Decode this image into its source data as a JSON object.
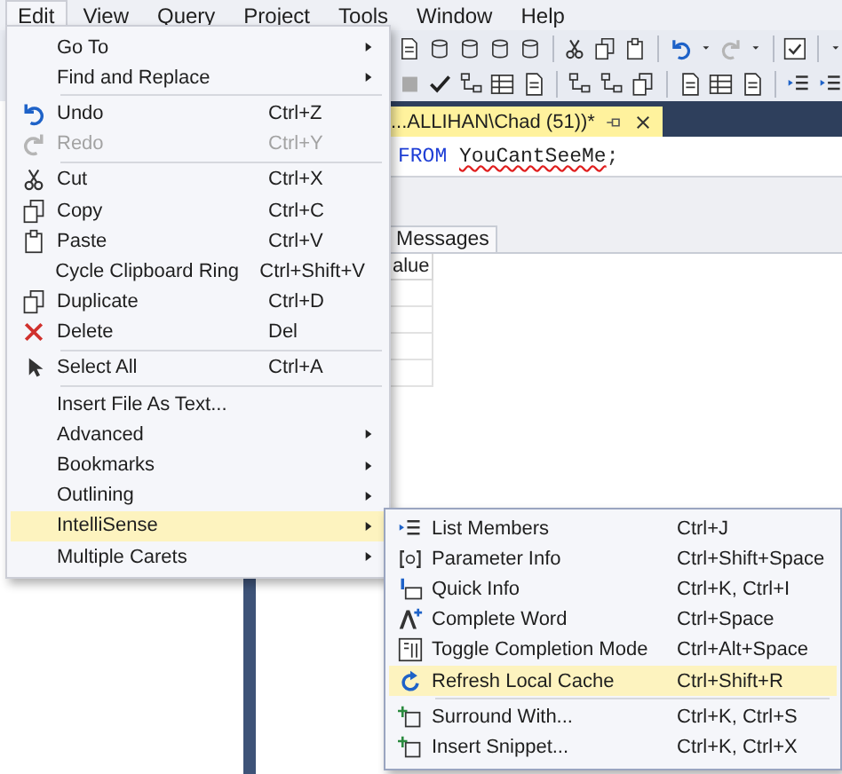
{
  "menu_bar": [
    {
      "label": "Edit",
      "selected": true
    },
    {
      "label": "View",
      "selected": false
    },
    {
      "label": "Query",
      "selected": false
    },
    {
      "label": "Project",
      "selected": false
    },
    {
      "label": "Tools",
      "selected": false
    },
    {
      "label": "Window",
      "selected": false
    },
    {
      "label": "Help",
      "selected": false
    }
  ],
  "editor_tab": {
    "title": "...ALLIHAN\\Chad (51))*"
  },
  "code_line": [
    {
      "text": "FROM",
      "kind": "keyword"
    },
    {
      "text": "YouCantSeeMe",
      "kind": "error"
    },
    {
      "text": ";",
      "kind": "plain"
    }
  ],
  "results_tabs": [
    {
      "label": "Messages"
    }
  ],
  "grid": {
    "column": "alue"
  },
  "edit_menu": {
    "items": [
      {
        "kind": "item",
        "label": "Go To",
        "submenu": true,
        "disabled": false,
        "selected": false
      },
      {
        "kind": "item",
        "label": "Find and Replace",
        "submenu": true,
        "disabled": false,
        "selected": false
      },
      {
        "kind": "separator"
      },
      {
        "kind": "item",
        "label": "Undo",
        "shortcut": "Ctrl+Z",
        "submenu": false,
        "disabled": false,
        "selected": false
      },
      {
        "kind": "item",
        "label": "Redo",
        "shortcut": "Ctrl+Y",
        "submenu": false,
        "disabled": true,
        "selected": false
      },
      {
        "kind": "separator"
      },
      {
        "kind": "item",
        "label": "Cut",
        "shortcut": "Ctrl+X",
        "submenu": false,
        "disabled": false,
        "selected": false
      },
      {
        "kind": "item",
        "label": "Copy",
        "shortcut": "Ctrl+C",
        "submenu": false,
        "disabled": false,
        "selected": false
      },
      {
        "kind": "item",
        "label": "Paste",
        "shortcut": "Ctrl+V",
        "submenu": false,
        "disabled": false,
        "selected": false
      },
      {
        "kind": "item",
        "label": "Cycle Clipboard Ring",
        "shortcut": "Ctrl+Shift+V",
        "submenu": false,
        "disabled": false,
        "selected": false
      },
      {
        "kind": "item",
        "label": "Duplicate",
        "shortcut": "Ctrl+D",
        "submenu": false,
        "disabled": false,
        "selected": false
      },
      {
        "kind": "item",
        "label": "Delete",
        "shortcut": "Del",
        "submenu": false,
        "disabled": false,
        "selected": false
      },
      {
        "kind": "separator"
      },
      {
        "kind": "item",
        "label": "Select All",
        "shortcut": "Ctrl+A",
        "submenu": false,
        "disabled": false,
        "selected": false
      },
      {
        "kind": "separator"
      },
      {
        "kind": "item",
        "label": "Insert File As Text...",
        "submenu": false,
        "disabled": false,
        "selected": false
      },
      {
        "kind": "item",
        "label": "Advanced",
        "submenu": true,
        "disabled": false,
        "selected": false
      },
      {
        "kind": "item",
        "label": "Bookmarks",
        "submenu": true,
        "disabled": false,
        "selected": false
      },
      {
        "kind": "item",
        "label": "Outlining",
        "submenu": true,
        "disabled": false,
        "selected": false
      },
      {
        "kind": "item",
        "label": "IntelliSense",
        "submenu": true,
        "disabled": false,
        "selected": true
      },
      {
        "kind": "item",
        "label": "Multiple Carets",
        "submenu": true,
        "disabled": false,
        "selected": false
      }
    ]
  },
  "intellisense_menu": {
    "items": [
      {
        "kind": "item",
        "label": "List Members",
        "shortcut": "Ctrl+J",
        "selected": false
      },
      {
        "kind": "item",
        "label": "Parameter Info",
        "shortcut": "Ctrl+Shift+Space",
        "selected": false
      },
      {
        "kind": "item",
        "label": "Quick Info",
        "shortcut": "Ctrl+K, Ctrl+I",
        "selected": false
      },
      {
        "kind": "item",
        "label": "Complete Word",
        "shortcut": "Ctrl+Space",
        "selected": false
      },
      {
        "kind": "item",
        "label": "Toggle Completion Mode",
        "shortcut": "Ctrl+Alt+Space",
        "selected": false
      },
      {
        "kind": "item",
        "label": "Refresh Local Cache",
        "shortcut": "Ctrl+Shift+R",
        "selected": true
      },
      {
        "kind": "separator"
      },
      {
        "kind": "item",
        "label": "Surround With...",
        "shortcut": "Ctrl+K, Ctrl+S",
        "selected": false
      },
      {
        "kind": "item",
        "label": "Insert Snippet...",
        "shortcut": "Ctrl+K, Ctrl+X",
        "selected": false
      }
    ]
  }
}
